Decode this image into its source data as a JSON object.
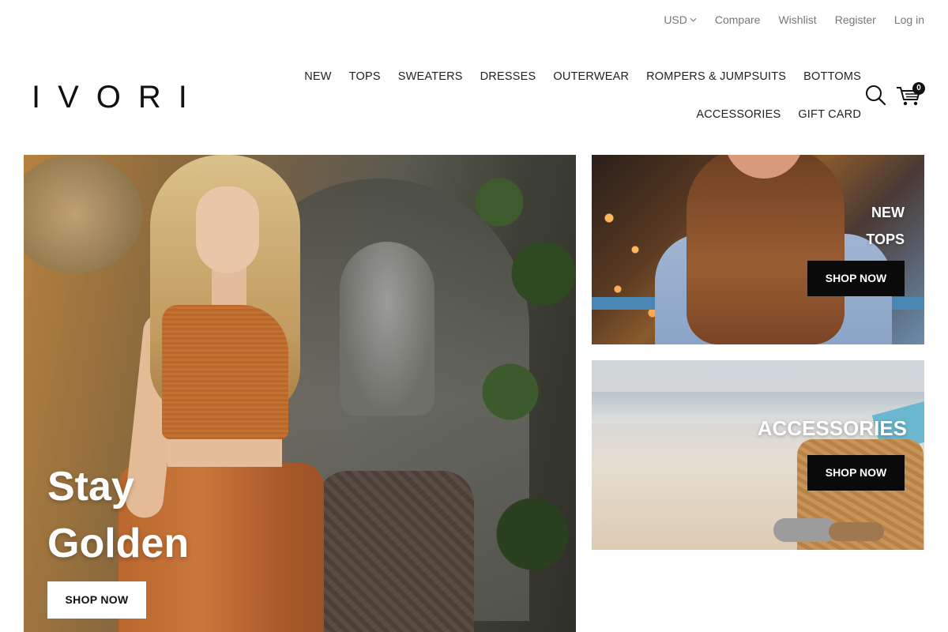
{
  "utility_bar": {
    "currency": "USD",
    "compare": "Compare",
    "wishlist": "Wishlist",
    "register": "Register",
    "login": "Log in"
  },
  "logo": "IVORI",
  "nav": {
    "items": [
      "NEW",
      "TOPS",
      "SWEATERS",
      "DRESSES",
      "OUTERWEAR",
      "ROMPERS & JUMPSUITS",
      "BOTTOMS",
      "ACCESSORIES",
      "GIFT CARD"
    ]
  },
  "cart": {
    "count": "0"
  },
  "icons": {
    "search": "search-icon",
    "cart": "cart-icon",
    "currency_dropdown": "chevron-down-icon"
  },
  "hero": {
    "headline_line1": "Stay",
    "headline_line2": "Golden",
    "cta": "SHOP NOW"
  },
  "promos": [
    {
      "label_line1": "NEW",
      "label_line2": "TOPS",
      "cta": "SHOP NOW"
    },
    {
      "label_line1": "ACCESSORIES",
      "cta": "SHOP NOW"
    }
  ],
  "colors": {
    "text": "#222222",
    "muted": "#777777",
    "button_dark": "#0a0a0a",
    "button_light": "#ffffff"
  }
}
